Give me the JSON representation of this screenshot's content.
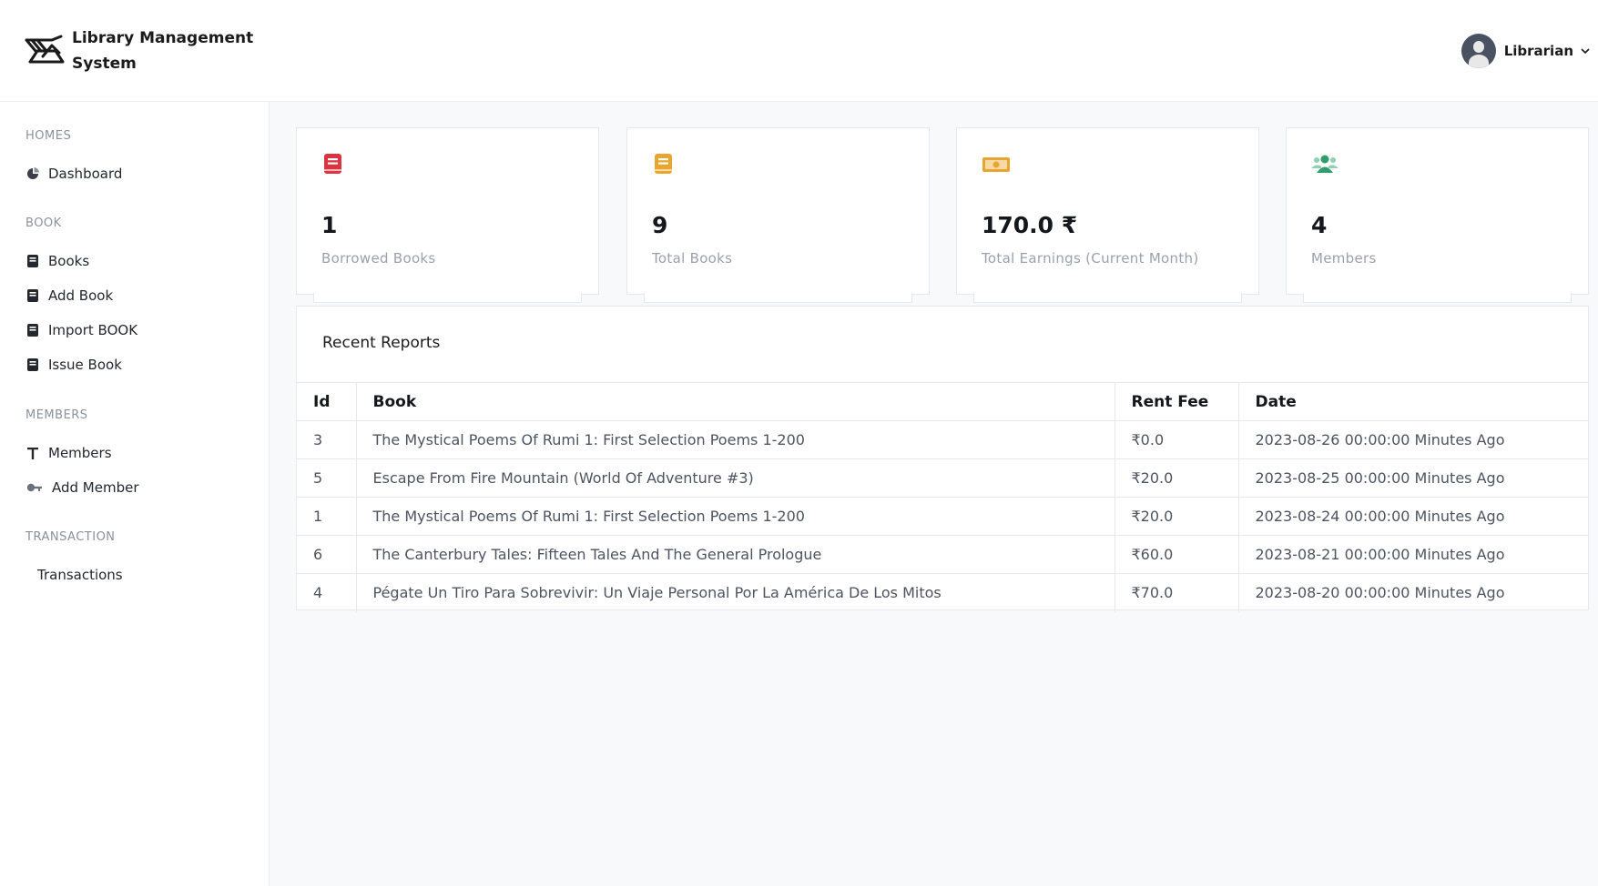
{
  "header": {
    "app_title_line1": "Library Management",
    "app_title_line2": "System",
    "user_name": "Librarian"
  },
  "sidebar": {
    "sections": [
      {
        "title": "HOMES",
        "items": [
          {
            "label": "Dashboard",
            "icon": "pie-chart-icon"
          }
        ]
      },
      {
        "title": "BOOK",
        "items": [
          {
            "label": "Books",
            "icon": "book-icon"
          },
          {
            "label": "Add Book",
            "icon": "book-icon"
          },
          {
            "label": "Import BOOK",
            "icon": "book-icon"
          },
          {
            "label": "Issue Book",
            "icon": "book-icon"
          }
        ]
      },
      {
        "title": "MEMBERS",
        "items": [
          {
            "label": "Members",
            "icon": "text-icon"
          },
          {
            "label": "Add Member",
            "icon": "key-icon"
          }
        ]
      },
      {
        "title": "TRANSACTION",
        "items": [
          {
            "label": "Transactions",
            "icon": ""
          }
        ]
      }
    ]
  },
  "stats": [
    {
      "value": "1",
      "label": "Borrowed Books",
      "icon": "book-icon",
      "color": "#d9343f"
    },
    {
      "value": "9",
      "label": "Total Books",
      "icon": "book-icon",
      "color": "#e8a530"
    },
    {
      "value": "170.0 ₹",
      "label": "Total Earnings (Current Month)",
      "icon": "money-icon",
      "color": "#e8a530"
    },
    {
      "value": "4",
      "label": "Members",
      "icon": "users-icon",
      "color": "#2e9e6c"
    }
  ],
  "reports": {
    "title": "Recent Reports",
    "columns": [
      "Id",
      "Book",
      "Rent Fee",
      "Date"
    ],
    "rows": [
      {
        "id": "3",
        "book": "The Mystical Poems Of Rumi 1: First Selection Poems 1-200",
        "fee": "₹0.0",
        "date": "2023-08-26 00:00:00 Minutes Ago"
      },
      {
        "id": "5",
        "book": "Escape From Fire Mountain (World Of Adventure #3)",
        "fee": "₹20.0",
        "date": "2023-08-25 00:00:00 Minutes Ago"
      },
      {
        "id": "1",
        "book": "The Mystical Poems Of Rumi 1: First Selection Poems 1-200",
        "fee": "₹20.0",
        "date": "2023-08-24 00:00:00 Minutes Ago"
      },
      {
        "id": "6",
        "book": "The Canterbury Tales: Fifteen Tales And The General Prologue",
        "fee": "₹60.0",
        "date": "2023-08-21 00:00:00 Minutes Ago"
      },
      {
        "id": "4",
        "book": "Pégate Un Tiro Para Sobrevivir: Un Viaje Personal Por La América De Los Mitos",
        "fee": "₹70.0",
        "date": "2023-08-20 00:00:00 Minutes Ago"
      }
    ]
  }
}
